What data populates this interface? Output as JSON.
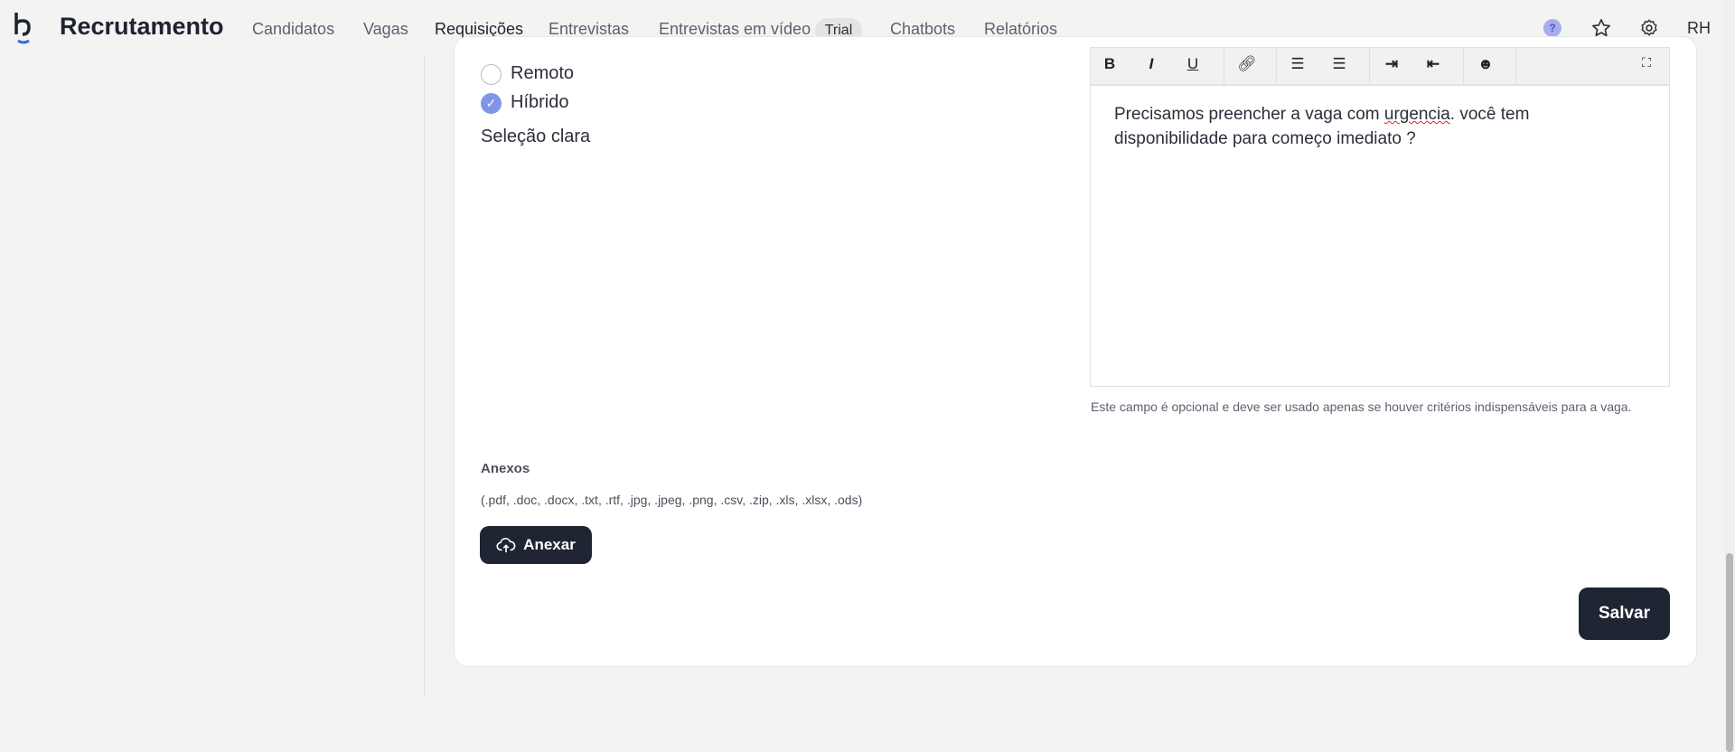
{
  "header": {
    "brand": "Recrutamento",
    "nav": [
      "Candidatos",
      "Vagas",
      "Requisições",
      "Entrevistas",
      "Entrevistas em vídeo",
      "Chatbots",
      "Relatórios"
    ],
    "trial_badge": "Trial",
    "help": "?",
    "avatar": "RH"
  },
  "form": {
    "radios": [
      {
        "label": "Remoto",
        "checked": false
      },
      {
        "label": "Híbrido",
        "checked": true
      }
    ],
    "selection_text": "Seleção clara"
  },
  "editor": {
    "toolbar": {
      "bold": "B",
      "italic": "I",
      "underline": "U"
    },
    "text_before": "Precisamos preencher a vaga com ",
    "misspelled": "urgencia",
    "text_after": ". você tem disponibilidade para começo imediato ?",
    "hint": "Este campo é opcional e deve ser usado apenas se houver critérios indispensáveis para a vaga."
  },
  "attachments": {
    "label": "Anexos",
    "formats": "(.pdf, .doc, .docx, .txt, .rtf, .jpg, .jpeg, .png, .csv, .zip, .xls, .xlsx, .ods)",
    "button": "Anexar"
  },
  "actions": {
    "save": "Salvar"
  },
  "colors": {
    "accent": "#7f96e6",
    "dark": "#1f2533"
  }
}
